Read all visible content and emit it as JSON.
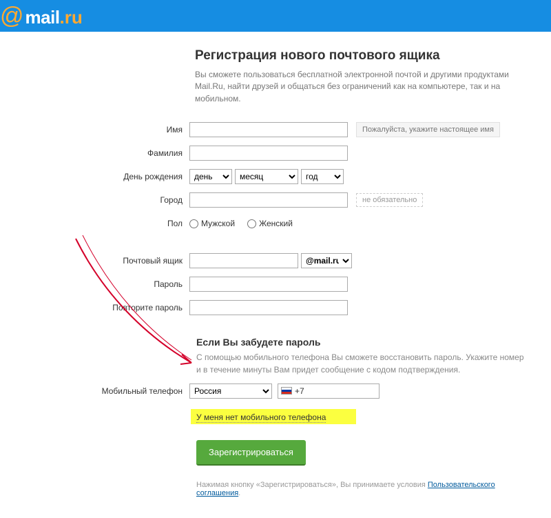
{
  "header": {
    "logo_at": "@",
    "logo_mail": "mail",
    "logo_dot": ".",
    "logo_ru": "ru"
  },
  "page": {
    "title": "Регистрация нового почтового ящика",
    "subtitle": "Вы сможете пользоваться бесплатной электронной почтой и другими продуктами Mail.Ru, найти друзей и общаться без ограничений как на компьютере, так и на мобильном."
  },
  "labels": {
    "first_name": "Имя",
    "last_name": "Фамилия",
    "birthday": "День рождения",
    "city": "Город",
    "gender": "Пол",
    "mailbox": "Почтовый ящик",
    "password": "Пароль",
    "password_repeat": "Повторите пароль",
    "mobile": "Мобильный телефон"
  },
  "hints": {
    "real_name": "Пожалуйста, укажите настоящее имя",
    "optional": "не обязательно"
  },
  "birthday": {
    "day_placeholder": "день",
    "month_placeholder": "месяц",
    "year_placeholder": "год"
  },
  "gender": {
    "male": "Мужской",
    "female": "Женский"
  },
  "mailbox": {
    "domain_selected": "@mail.ru"
  },
  "recovery": {
    "title": "Если Вы забудете пароль",
    "desc": "С помощью мобильного телефона Вы сможете восстановить пароль. Укажите номер и в течение минуты Вам придет сообщение с кодом подтверждения.",
    "country_selected": "Россия",
    "phone_prefix": "+7",
    "no_phone_link": "У меня нет мобильного телефона"
  },
  "submit": {
    "button": "Зарегистрироваться"
  },
  "terms": {
    "text": "Нажимая кнопку «Зарегистрироваться», Вы принимаете условия ",
    "link": "Пользовательского соглашения",
    "suffix": "."
  }
}
